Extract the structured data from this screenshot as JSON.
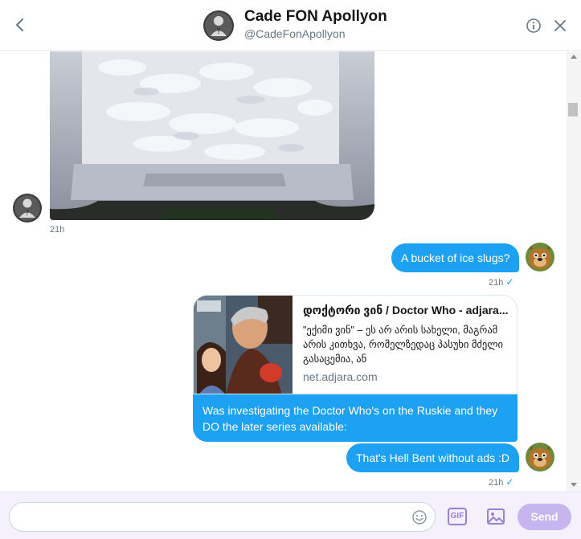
{
  "header": {
    "name": "Cade FON Apollyon",
    "handle": "@CadeFonApollyon",
    "back_icon": "chevron-left-icon",
    "info_icon": "info-icon",
    "close_icon": "close-icon"
  },
  "messages": [
    {
      "id": "m1",
      "type": "photo",
      "direction": "incoming",
      "description": "ice-bucket-photo",
      "timestamp": "21h"
    },
    {
      "id": "m2",
      "type": "text",
      "direction": "outgoing",
      "text": "A bucket of ice slugs?",
      "timestamp": "21h",
      "status": "✓"
    },
    {
      "id": "m3",
      "type": "link-card",
      "direction": "outgoing",
      "card": {
        "title": "დოქტორი ვინ / Doctor Who - adjara...",
        "description": "\"ექიმი ვინ\" – ეს არ არის სახელი, მაგრამ არის კითხვა, რომელზედაც პასუხი მძელი გასაცემია, ან",
        "domain": "net.adjara.com"
      },
      "text": "Was investigating the Doctor Who's on the Ruskie and they DO the later series available:"
    },
    {
      "id": "m4",
      "type": "text",
      "direction": "outgoing",
      "text": "That's Hell Bent without ads :D",
      "timestamp": "21h",
      "status": "✓"
    }
  ],
  "composer": {
    "placeholder": "",
    "gif_label": "GIF",
    "send_label": "Send",
    "emoji_icon": "emoji-icon",
    "image_icon": "image-icon"
  },
  "colors": {
    "accent": "#1da1f2",
    "purple": "#9b7fd6",
    "send_disabled": "#c7b5ef",
    "composer_bg": "#f4f0fc"
  }
}
